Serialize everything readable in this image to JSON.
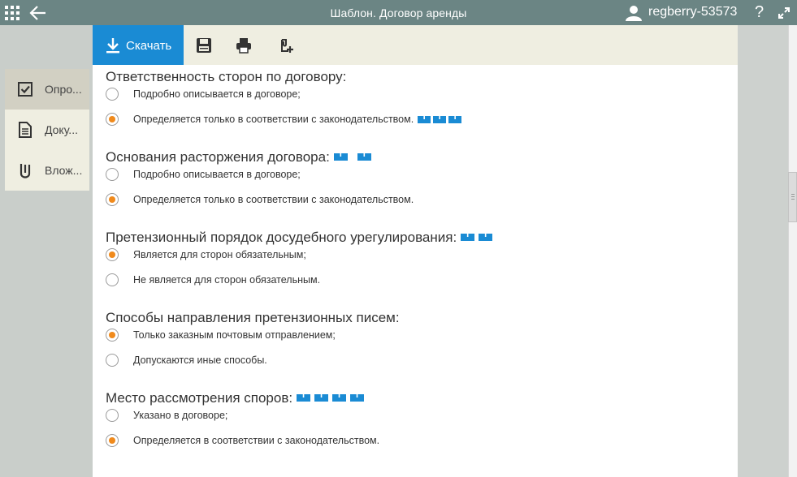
{
  "header": {
    "title": "Шаблон. Договор аренды",
    "user": "regberry-53573",
    "help_label": "?"
  },
  "toolbar": {
    "download_label": "Скачать",
    "icons": [
      "save-icon",
      "print-icon",
      "export-icon"
    ]
  },
  "sidebar": {
    "items": [
      {
        "label": "Опро...",
        "icon": "checkbox-icon",
        "active": true
      },
      {
        "label": "Доку...",
        "icon": "document-icon",
        "active": false
      },
      {
        "label": "Влож...",
        "icon": "attachment-icon",
        "active": false
      }
    ]
  },
  "sections": [
    {
      "title": "Ответственность сторон по договору:",
      "title_badges": 0,
      "options": [
        {
          "label": "Подробно описывается в договоре;",
          "checked": false,
          "badges": 0
        },
        {
          "label": "Определяется только в соответствии с законодательством.",
          "checked": true,
          "badges": 3
        }
      ]
    },
    {
      "title": "Основания расторжения договора:",
      "title_badges": 2,
      "options": [
        {
          "label": "Подробно описывается в договоре;",
          "checked": false,
          "badges": 0
        },
        {
          "label": "Определяется только в соответствии с законодательством.",
          "checked": true,
          "badges": 0
        }
      ]
    },
    {
      "title": "Претензионный порядок досудебного урегулирования:",
      "title_badges": 2,
      "options": [
        {
          "label": "Является для сторон обязательным;",
          "checked": true,
          "badges": 0
        },
        {
          "label": "Не является для сторон обязательным.",
          "checked": false,
          "badges": 0
        }
      ]
    },
    {
      "title": "Способы направления претензионных писем:",
      "title_badges": 0,
      "options": [
        {
          "label": "Только заказным почтовым отправлением;",
          "checked": true,
          "badges": 0
        },
        {
          "label": "Допускаются иные способы.",
          "checked": false,
          "badges": 0
        }
      ]
    },
    {
      "title": "Место рассмотрения споров:",
      "title_badges": 4,
      "options": [
        {
          "label": "Указано в договоре;",
          "checked": false,
          "badges": 0
        },
        {
          "label": "Определяется в соответствии с законодательством.",
          "checked": true,
          "badges": 0
        }
      ]
    }
  ],
  "colors": {
    "header_bg": "#6b8584",
    "accent": "#1a8bd4",
    "radio_checked": "#f08a1c",
    "panel_bg": "#efeee1"
  }
}
